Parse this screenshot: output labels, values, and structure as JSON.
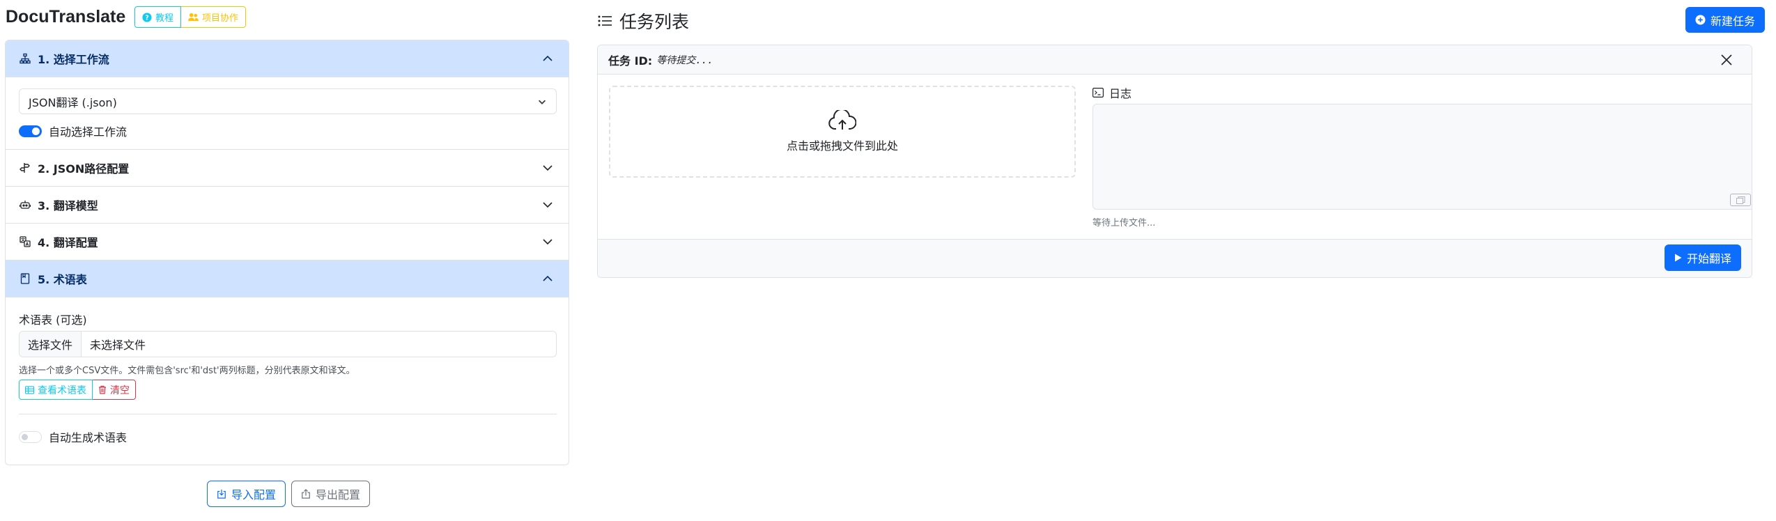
{
  "app": {
    "title": "DocuTranslate",
    "badges": {
      "tutorial": "教程",
      "collab": "项目协作"
    }
  },
  "sections": [
    {
      "number": "1.",
      "title": "选择工作流",
      "icon": "sitemap-icon",
      "expanded": true
    },
    {
      "number": "2.",
      "title": "JSON路径配置",
      "icon": "signpost-icon",
      "expanded": false
    },
    {
      "number": "3.",
      "title": "翻译模型",
      "icon": "robot-icon",
      "expanded": false
    },
    {
      "number": "4.",
      "title": "翻译配置",
      "icon": "translate-icon",
      "expanded": false
    },
    {
      "number": "5.",
      "title": "术语表",
      "icon": "book-icon",
      "expanded": true
    }
  ],
  "workflow": {
    "selected": "JSON翻译 (.json)",
    "auto_select_label": "自动选择工作流",
    "auto_select_on": true
  },
  "glossary": {
    "label": "术语表 (可选)",
    "choose_file": "选择文件",
    "no_file": "未选择文件",
    "help": "选择一个或多个CSV文件。文件需包含'src'和'dst'两列标题，分别代表原文和译文。",
    "view_btn": "查看术语表",
    "clear_btn": "清空",
    "auto_generate_label": "自动生成术语表",
    "auto_generate_on": false
  },
  "config_buttons": {
    "import": "导入配置",
    "export": "导出配置"
  },
  "tasks": {
    "title": "任务列表",
    "new_task": "新建任务",
    "task_id_label": "任务 ID:",
    "task_id_value": "等待提交...",
    "drop_text": "点击或拖拽文件到此处",
    "log_label": "日志",
    "status": "等待上传文件...",
    "start_btn": "开始翻译"
  },
  "colors": {
    "primary": "#0d6efd",
    "info": "#0dcaf0",
    "warning": "#ffc107",
    "danger": "#dc3545",
    "secondary": "#6c757d",
    "accordion_active_bg": "#cfe2ff"
  }
}
